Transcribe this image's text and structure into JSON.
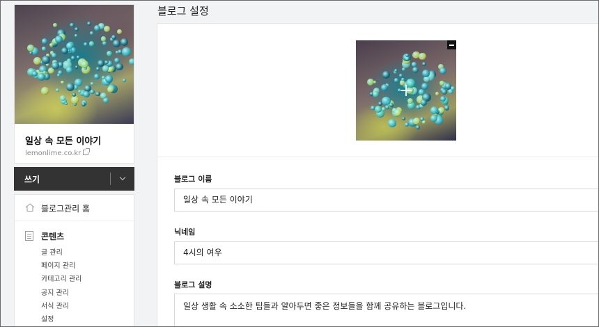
{
  "sidebar": {
    "blog_name": "일상 속 모든 이야기",
    "blog_url": "lemonlime.co.kr",
    "write_label": "쓰기",
    "home_label": "블로그관리 홈",
    "content_section": {
      "label": "콘텐츠",
      "items": [
        "글 관리",
        "페이지 관리",
        "카테고리 관리",
        "공지 관리",
        "서식 관리",
        "설정"
      ]
    }
  },
  "main": {
    "title": "블로그 설정",
    "fields": {
      "blog_name": {
        "label": "블로그 이름",
        "value": "일상 속 모든 이야기"
      },
      "nickname": {
        "label": "닉네임",
        "value": "4시의 여우"
      },
      "description": {
        "label": "블로그 설명",
        "value": "일상 생활 속 소소한 팁들과 알아두면 좋은 정보들을 함께 공유하는 블로그입니다."
      }
    }
  },
  "icons": {
    "external_link": "external-link-icon",
    "chevron": "chevron-down-icon",
    "home": "home-icon",
    "content": "document-icon",
    "remove": "minus-icon",
    "add": "plus-icon"
  },
  "colors": {
    "write_bar": "#333333",
    "page_bg": "#f2f3f5",
    "card_bg": "#ffffff"
  }
}
